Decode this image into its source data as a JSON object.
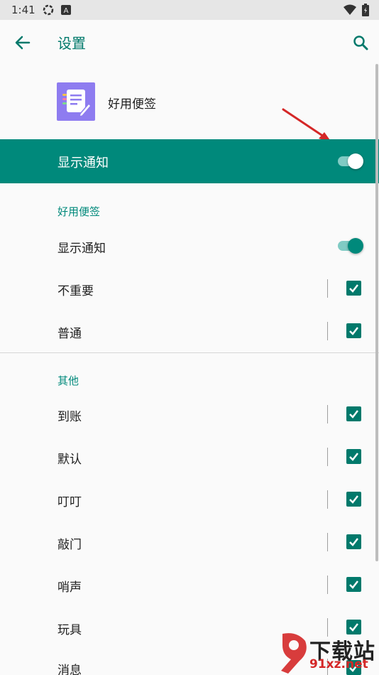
{
  "status_bar": {
    "time": "1:41"
  },
  "app_bar": {
    "title": "设置"
  },
  "app_info": {
    "name": "好用便签"
  },
  "master_toggle": {
    "label": "显示通知",
    "on": true
  },
  "sections": [
    {
      "header": "好用便签",
      "items": [
        {
          "label": "显示通知",
          "type": "switch",
          "on": true
        },
        {
          "label": "不重要",
          "type": "checkbox",
          "checked": true
        },
        {
          "label": "普通",
          "type": "checkbox",
          "checked": true
        }
      ]
    },
    {
      "header": "其他",
      "items": [
        {
          "label": "到账",
          "type": "checkbox",
          "checked": true
        },
        {
          "label": "默认",
          "type": "checkbox",
          "checked": true
        },
        {
          "label": "叮叮",
          "type": "checkbox",
          "checked": true
        },
        {
          "label": "敲门",
          "type": "checkbox",
          "checked": true
        },
        {
          "label": "哨声",
          "type": "checkbox",
          "checked": true
        },
        {
          "label": "玩具",
          "type": "checkbox",
          "checked": true
        },
        {
          "label": "消息",
          "type": "checkbox",
          "checked": true
        }
      ]
    }
  ],
  "watermark": {
    "brand": "下载站",
    "domain": "91xz.net"
  },
  "colors": {
    "accent": "#00897b",
    "accent_dark": "#00796b",
    "app_icon": "#8e7cf0",
    "annotation_arrow": "#d42727"
  },
  "icons": [
    "back-arrow-icon",
    "search-icon",
    "note-app-icon",
    "check-icon"
  ]
}
